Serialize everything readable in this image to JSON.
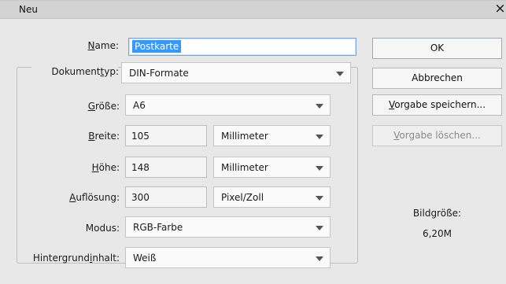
{
  "window": {
    "title": "Neu",
    "close_symbol": "×"
  },
  "form": {
    "name": {
      "label_underline": "N",
      "label_rest": "ame:",
      "value": "Postkarte"
    },
    "dokumenttyp": {
      "label_pre": "Dokument",
      "label_underline": "t",
      "label_rest": "yp:",
      "value": "DIN-Formate"
    },
    "groesse": {
      "label_underline": "G",
      "label_rest": "röße:",
      "value": "A6"
    },
    "breite": {
      "label_underline": "B",
      "label_rest": "reite:",
      "value": "105",
      "unit": "Millimeter"
    },
    "hoehe": {
      "label_underline": "H",
      "label_rest": "öhe:",
      "value": "148",
      "unit": "Millimeter"
    },
    "aufloesung": {
      "label_underline": "A",
      "label_rest": "uflösung:",
      "value": "300",
      "unit": "Pixel/Zoll"
    },
    "modus": {
      "label": "Modus:",
      "value": "RGB-Farbe"
    },
    "hintergrund": {
      "label_pre": "Hintergrund",
      "label_underline": "i",
      "label_rest": "nhalt:",
      "value": "Weiß"
    }
  },
  "buttons": {
    "ok": "OK",
    "cancel": "Abbrechen",
    "save_preset": {
      "underline": "V",
      "rest": "orgabe speichern..."
    },
    "delete_preset": {
      "underline": "V",
      "rest": "orgabe löschen..."
    }
  },
  "image_size": {
    "label": "Bildgröße:",
    "value": "6,20M"
  }
}
